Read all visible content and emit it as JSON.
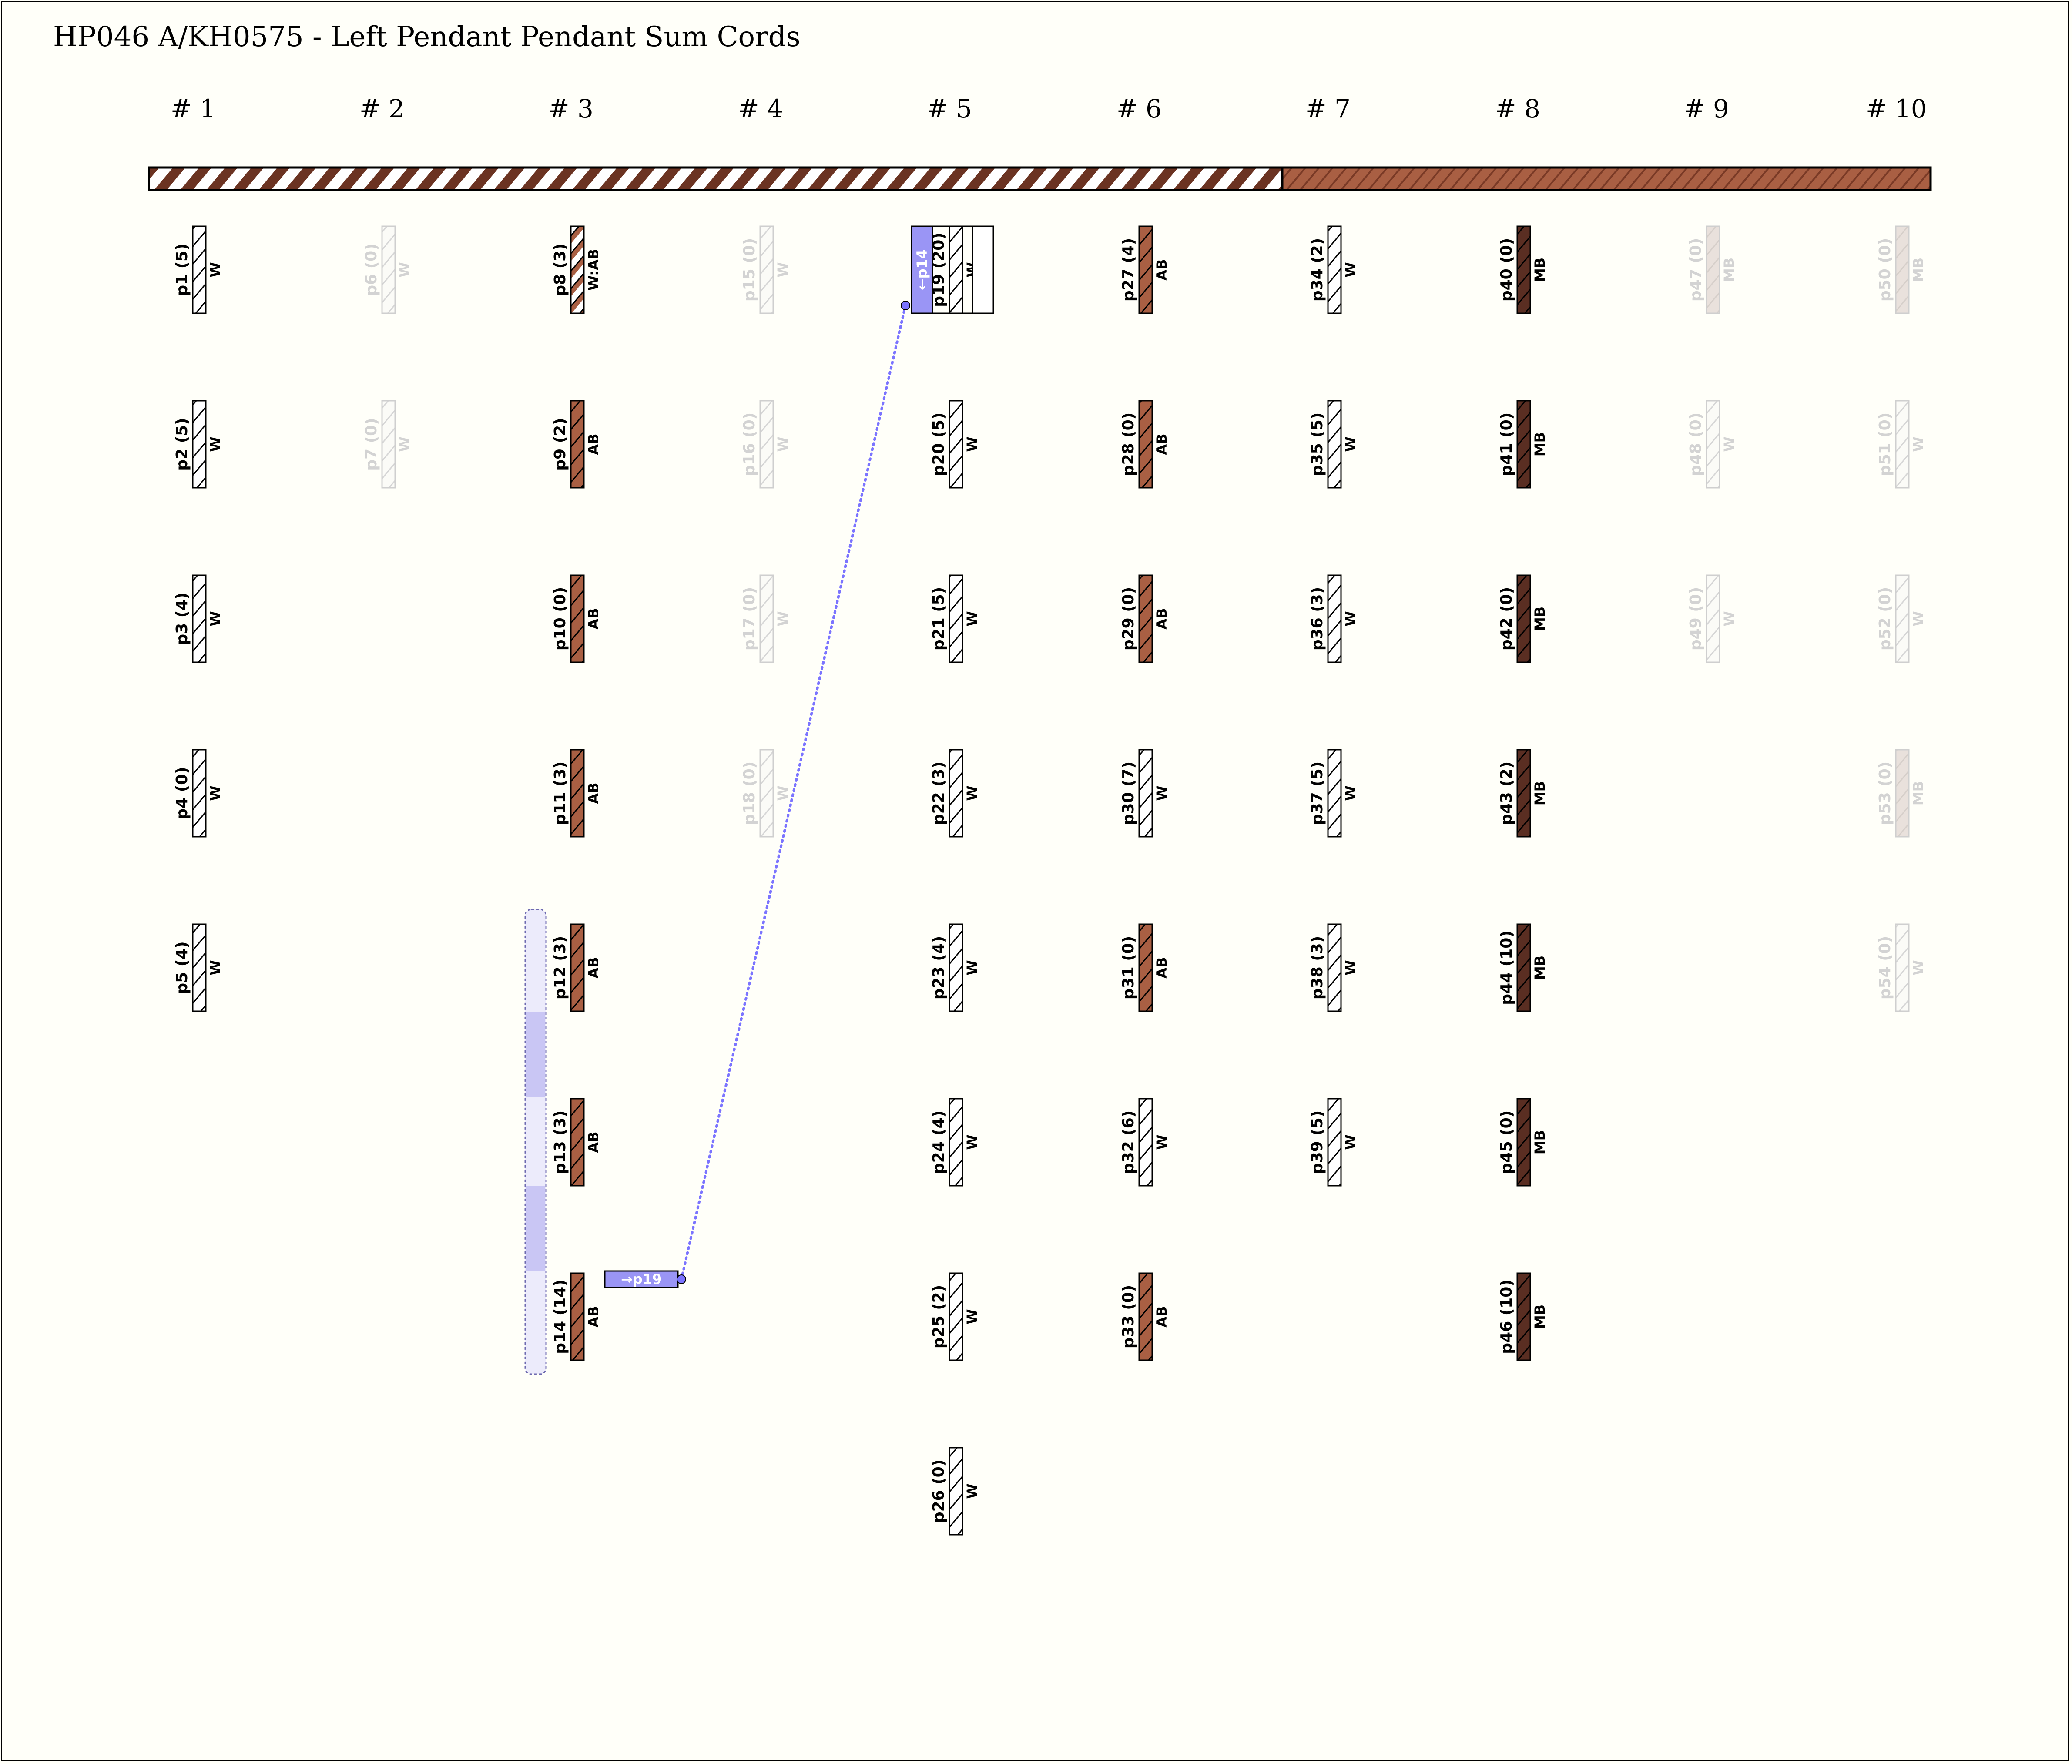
{
  "title": "HP046 A/KH0575 - Left Pendant Pendant Sum Cords",
  "colors": {
    "background": "#fffff9",
    "white_cord": "#ffffff",
    "ab_cord": "#a95f43",
    "mb_cord": "#5a2e22",
    "faded": "#dcdcdc",
    "link": "#7b74ff",
    "link_box": "#9a95f5",
    "group_highlight": "#c9c6f4"
  },
  "groups": [
    {
      "label": "# 1",
      "cords": [
        {
          "name": "p1 (5)",
          "color": "W",
          "kind": "W"
        },
        {
          "name": "p2 (5)",
          "color": "W",
          "kind": "W"
        },
        {
          "name": "p3 (4)",
          "color": "W",
          "kind": "W"
        },
        {
          "name": "p4 (0)",
          "color": "W",
          "kind": "W"
        },
        {
          "name": "p5 (4)",
          "color": "W",
          "kind": "W"
        }
      ]
    },
    {
      "label": "# 2",
      "cords": [
        {
          "name": "p6 (0)",
          "color": "W",
          "kind": "W",
          "faded": true
        },
        {
          "name": "p7 (0)",
          "color": "W",
          "kind": "W",
          "faded": true
        }
      ]
    },
    {
      "label": "# 3",
      "cords": [
        {
          "name": "p8 (3)",
          "color": "W:AB",
          "kind": "WAB"
        },
        {
          "name": "p9 (2)",
          "color": "AB",
          "kind": "AB"
        },
        {
          "name": "p10 (0)",
          "color": "AB",
          "kind": "AB"
        },
        {
          "name": "p11 (3)",
          "color": "AB",
          "kind": "AB"
        },
        {
          "name": "p12 (3)",
          "color": "AB",
          "kind": "AB"
        },
        {
          "name": "p13 (3)",
          "color": "AB",
          "kind": "AB"
        },
        {
          "name": "p14 (14)",
          "color": "AB",
          "kind": "AB"
        }
      ]
    },
    {
      "label": "# 4",
      "cords": [
        {
          "name": "p15 (0)",
          "color": "W",
          "kind": "W",
          "faded": true
        },
        {
          "name": "p16 (0)",
          "color": "W",
          "kind": "W",
          "faded": true
        },
        {
          "name": "p17 (0)",
          "color": "W",
          "kind": "W",
          "faded": true
        },
        {
          "name": "p18 (0)",
          "color": "W",
          "kind": "W",
          "faded": true
        }
      ]
    },
    {
      "label": "# 5",
      "cords": [
        {
          "name": "p19 (20)",
          "color": "W",
          "kind": "W"
        },
        {
          "name": "p20 (5)",
          "color": "W",
          "kind": "W"
        },
        {
          "name": "p21 (5)",
          "color": "W",
          "kind": "W"
        },
        {
          "name": "p22 (3)",
          "color": "W",
          "kind": "W"
        },
        {
          "name": "p23 (4)",
          "color": "W",
          "kind": "W"
        },
        {
          "name": "p24 (4)",
          "color": "W",
          "kind": "W"
        },
        {
          "name": "p25 (2)",
          "color": "W",
          "kind": "W"
        },
        {
          "name": "p26 (0)",
          "color": "W",
          "kind": "W"
        }
      ]
    },
    {
      "label": "# 6",
      "cords": [
        {
          "name": "p27 (4)",
          "color": "AB",
          "kind": "AB"
        },
        {
          "name": "p28 (0)",
          "color": "AB",
          "kind": "AB"
        },
        {
          "name": "p29 (0)",
          "color": "AB",
          "kind": "AB"
        },
        {
          "name": "p30 (7)",
          "color": "W",
          "kind": "W"
        },
        {
          "name": "p31 (0)",
          "color": "AB",
          "kind": "AB"
        },
        {
          "name": "p32 (6)",
          "color": "W",
          "kind": "W"
        },
        {
          "name": "p33 (0)",
          "color": "AB",
          "kind": "AB"
        }
      ]
    },
    {
      "label": "# 7",
      "cords": [
        {
          "name": "p34 (2)",
          "color": "W",
          "kind": "W"
        },
        {
          "name": "p35 (5)",
          "color": "W",
          "kind": "W"
        },
        {
          "name": "p36 (3)",
          "color": "W",
          "kind": "W"
        },
        {
          "name": "p37 (5)",
          "color": "W",
          "kind": "W"
        },
        {
          "name": "p38 (3)",
          "color": "W",
          "kind": "W"
        },
        {
          "name": "p39 (5)",
          "color": "W",
          "kind": "W"
        }
      ]
    },
    {
      "label": "# 8",
      "cords": [
        {
          "name": "p40 (0)",
          "color": "MB",
          "kind": "MB"
        },
        {
          "name": "p41 (0)",
          "color": "MB",
          "kind": "MB"
        },
        {
          "name": "p42 (0)",
          "color": "MB",
          "kind": "MB"
        },
        {
          "name": "p43 (2)",
          "color": "MB",
          "kind": "MB"
        },
        {
          "name": "p44 (10)",
          "color": "MB",
          "kind": "MB"
        },
        {
          "name": "p45 (0)",
          "color": "MB",
          "kind": "MB"
        },
        {
          "name": "p46 (10)",
          "color": "MB",
          "kind": "MB"
        }
      ]
    },
    {
      "label": "# 9",
      "cords": [
        {
          "name": "p47 (0)",
          "color": "MB",
          "kind": "MB",
          "faded": true
        },
        {
          "name": "p48 (0)",
          "color": "W",
          "kind": "W",
          "faded": true
        },
        {
          "name": "p49 (0)",
          "color": "W",
          "kind": "W",
          "faded": true
        }
      ]
    },
    {
      "label": "# 10",
      "cords": [
        {
          "name": "p50 (0)",
          "color": "MB",
          "kind": "MB",
          "faded": true
        },
        {
          "name": "p51 (0)",
          "color": "W",
          "kind": "W",
          "faded": true
        },
        {
          "name": "p52 (0)",
          "color": "W",
          "kind": "W",
          "faded": true
        },
        {
          "name": "p53 (0)",
          "color": "MB",
          "kind": "MB",
          "faded": true
        },
        {
          "name": "p54 (0)",
          "color": "W",
          "kind": "W",
          "faded": true
        }
      ]
    }
  ],
  "link": {
    "from": "p14 (14)",
    "to": "p19 (20)",
    "out_label": "→p19",
    "in_label": "←p14"
  },
  "primary_cord": {
    "segments": [
      {
        "pattern": "white-brown-diagonal"
      },
      {
        "pattern": "brown-diagonal"
      }
    ]
  }
}
